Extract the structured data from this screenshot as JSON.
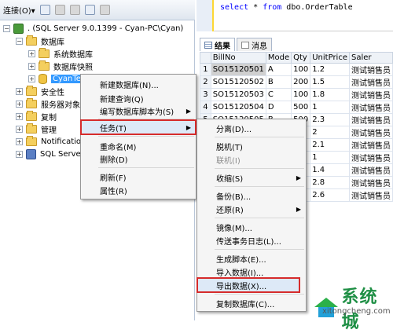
{
  "toolbar": {
    "connect_label": "连接(O)▾"
  },
  "tree": {
    "server": ". (SQL Server 9.0.1399 - Cyan-PC\\Cyan)",
    "items": {
      "databases": "数据库",
      "system_db": "系统数据库",
      "snapshots": "数据库快照",
      "cyantest": "CyanTest",
      "security": "安全性",
      "server_objects": "服务器对象",
      "replication": "复制",
      "management": "管理",
      "notification": "Notification",
      "agent": "SQL Server"
    }
  },
  "query": {
    "text_kw1": "select",
    "text_mid": " * ",
    "text_kw2": "from",
    "text_tail": " dbo.OrderTable"
  },
  "result_tabs": {
    "results": "结果",
    "messages": "消息"
  },
  "grid": {
    "columns": [
      "BillNo",
      "Mode",
      "Qty",
      "UnitPrice",
      "Saler"
    ],
    "rows": [
      {
        "n": "1",
        "billno": "SO15120501",
        "mode": "A",
        "qty": "100",
        "price": "1.2",
        "saler": "测试销售员"
      },
      {
        "n": "2",
        "billno": "SO15120502",
        "mode": "B",
        "qty": "200",
        "price": "1.5",
        "saler": "测试销售员"
      },
      {
        "n": "3",
        "billno": "SO15120503",
        "mode": "C",
        "qty": "100",
        "price": "1.8",
        "saler": "测试销售员"
      },
      {
        "n": "4",
        "billno": "SO15120504",
        "mode": "D",
        "qty": "500",
        "price": "1",
        "saler": "测试销售员"
      },
      {
        "n": "5",
        "billno": "SO15120505",
        "mode": "B",
        "qty": "500",
        "price": "2.3",
        "saler": "测试销售员"
      },
      {
        "n": "",
        "billno": "",
        "mode": "",
        "qty": "",
        "price": "2",
        "saler": "测试销售员"
      },
      {
        "n": "",
        "billno": "",
        "mode": "",
        "qty": "",
        "price": "2.1",
        "saler": "测试销售员"
      },
      {
        "n": "",
        "billno": "",
        "mode": "",
        "qty": "",
        "price": "1",
        "saler": "测试销售员"
      },
      {
        "n": "",
        "billno": "",
        "mode": "",
        "qty": "",
        "price": "1.4",
        "saler": "测试销售员"
      },
      {
        "n": "",
        "billno": "",
        "mode": "",
        "qty": "",
        "price": "2.8",
        "saler": "测试销售员"
      },
      {
        "n": "",
        "billno": "",
        "mode": "",
        "qty": "",
        "price": "2.6",
        "saler": "测试销售员"
      }
    ]
  },
  "context_menu": {
    "new_db": "新建数据库(N)...",
    "new_query": "新建查询(Q)",
    "script_db": "编写数据库脚本为(S)",
    "tasks": "任务(T)",
    "rename": "重命名(M)",
    "delete": "删除(D)",
    "refresh": "刷新(F)",
    "properties": "属性(R)"
  },
  "tasks_menu": {
    "detach": "分离(D)...",
    "offline": "脱机(T)",
    "online": "联机(I)",
    "shrink": "收缩(S)",
    "backup": "备份(B)...",
    "restore": "还原(R)",
    "mirror": "镜像(M)...",
    "log_ship": "传送事务日志(L)...",
    "gen_scripts": "生成脚本(E)...",
    "import": "导入数据(I)...",
    "export": "导出数据(X)...",
    "copy_db": "复制数据库(C)..."
  },
  "watermark": {
    "brand": "系统城",
    "site": "xitongcheng.com"
  }
}
